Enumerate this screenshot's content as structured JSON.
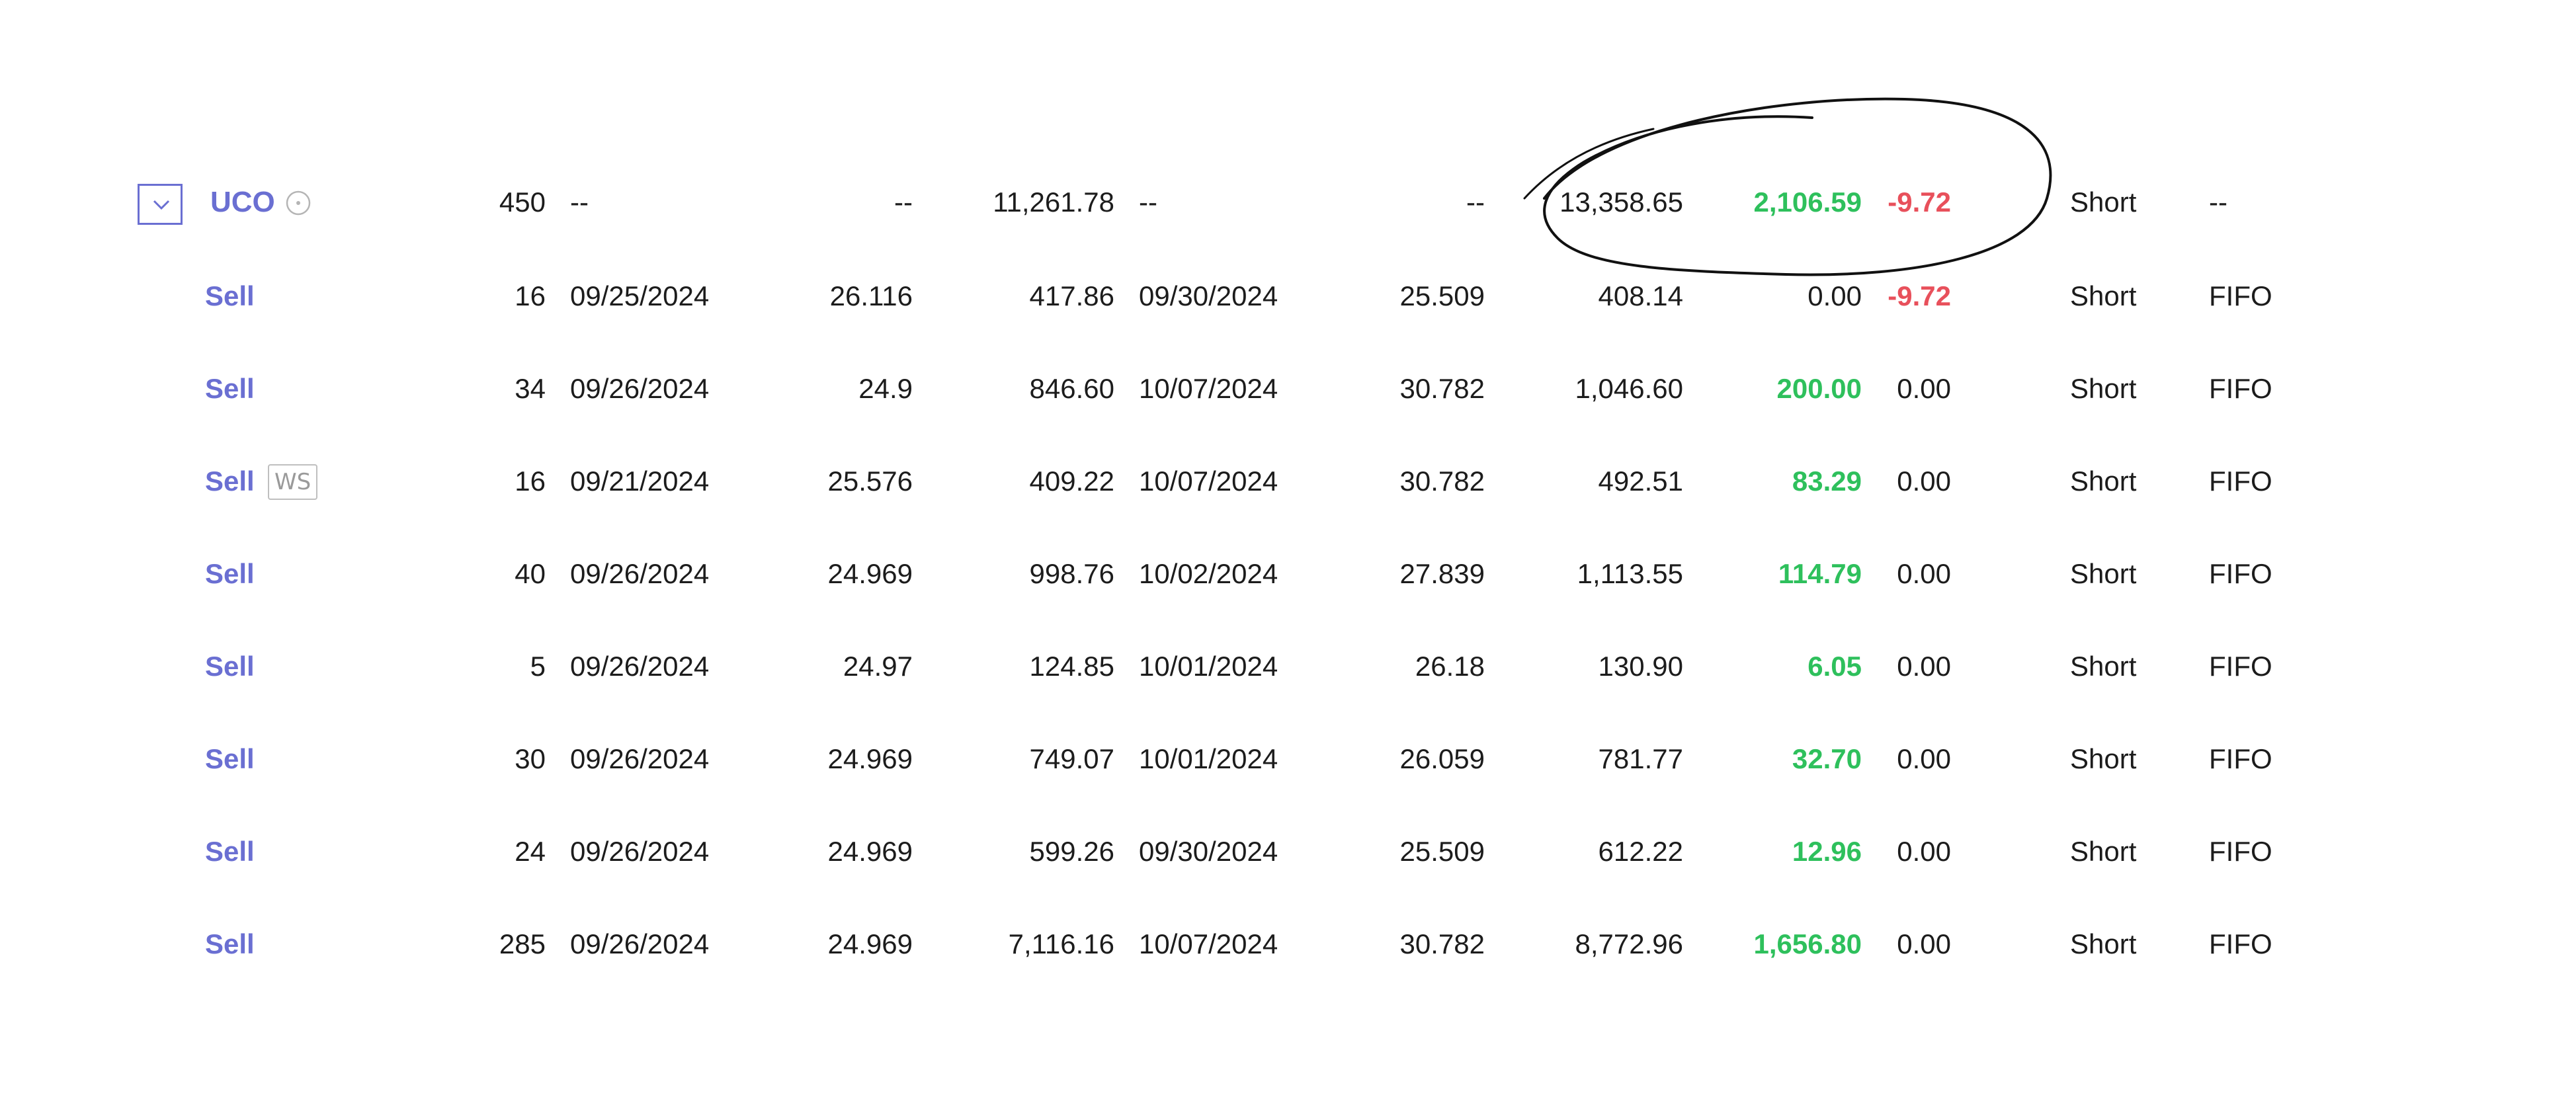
{
  "parent": {
    "symbol": "UCO",
    "quantity": "450",
    "open_date": "--",
    "open_price": "--",
    "cost_basis": "11,261.78",
    "close_date": "--",
    "close_price": "--",
    "proceeds": "13,358.65",
    "gain_loss": "2,106.59",
    "wash_sale": "-9.72",
    "term": "Short",
    "method": "--"
  },
  "lots": [
    {
      "action": "Sell",
      "badge": "",
      "quantity": "16",
      "open_date": "09/25/2024",
      "open_price": "26.116",
      "cost_basis": "417.86",
      "close_date": "09/30/2024",
      "close_price": "25.509",
      "proceeds": "408.14",
      "gain_loss": "0.00",
      "gain_color": "neutral",
      "wash_sale": "-9.72",
      "wash_color": "red",
      "term": "Short",
      "method": "FIFO"
    },
    {
      "action": "Sell",
      "badge": "",
      "quantity": "34",
      "open_date": "09/26/2024",
      "open_price": "24.9",
      "cost_basis": "846.60",
      "close_date": "10/07/2024",
      "close_price": "30.782",
      "proceeds": "1,046.60",
      "gain_loss": "200.00",
      "gain_color": "green",
      "wash_sale": "0.00",
      "wash_color": "neutral",
      "term": "Short",
      "method": "FIFO"
    },
    {
      "action": "Sell",
      "badge": "WS",
      "quantity": "16",
      "open_date": "09/21/2024",
      "open_price": "25.576",
      "cost_basis": "409.22",
      "close_date": "10/07/2024",
      "close_price": "30.782",
      "proceeds": "492.51",
      "gain_loss": "83.29",
      "gain_color": "green",
      "wash_sale": "0.00",
      "wash_color": "neutral",
      "term": "Short",
      "method": "FIFO"
    },
    {
      "action": "Sell",
      "badge": "",
      "quantity": "40",
      "open_date": "09/26/2024",
      "open_price": "24.969",
      "cost_basis": "998.76",
      "close_date": "10/02/2024",
      "close_price": "27.839",
      "proceeds": "1,113.55",
      "gain_loss": "114.79",
      "gain_color": "green",
      "wash_sale": "0.00",
      "wash_color": "neutral",
      "term": "Short",
      "method": "FIFO"
    },
    {
      "action": "Sell",
      "badge": "",
      "quantity": "5",
      "open_date": "09/26/2024",
      "open_price": "24.97",
      "cost_basis": "124.85",
      "close_date": "10/01/2024",
      "close_price": "26.18",
      "proceeds": "130.90",
      "gain_loss": "6.05",
      "gain_color": "green",
      "wash_sale": "0.00",
      "wash_color": "neutral",
      "term": "Short",
      "method": "FIFO"
    },
    {
      "action": "Sell",
      "badge": "",
      "quantity": "30",
      "open_date": "09/26/2024",
      "open_price": "24.969",
      "cost_basis": "749.07",
      "close_date": "10/01/2024",
      "close_price": "26.059",
      "proceeds": "781.77",
      "gain_loss": "32.70",
      "gain_color": "green",
      "wash_sale": "0.00",
      "wash_color": "neutral",
      "term": "Short",
      "method": "FIFO"
    },
    {
      "action": "Sell",
      "badge": "",
      "quantity": "24",
      "open_date": "09/26/2024",
      "open_price": "24.969",
      "cost_basis": "599.26",
      "close_date": "09/30/2024",
      "close_price": "25.509",
      "proceeds": "612.22",
      "gain_loss": "12.96",
      "gain_color": "green",
      "wash_sale": "0.00",
      "wash_color": "neutral",
      "term": "Short",
      "method": "FIFO"
    },
    {
      "action": "Sell",
      "badge": "",
      "quantity": "285",
      "open_date": "09/26/2024",
      "open_price": "24.969",
      "cost_basis": "7,116.16",
      "close_date": "10/07/2024",
      "close_price": "30.782",
      "proceeds": "8,772.96",
      "gain_loss": "1,656.80",
      "gain_color": "green",
      "wash_sale": "0.00",
      "wash_color": "neutral",
      "term": "Short",
      "method": "FIFO"
    }
  ],
  "colors": {
    "accent": "#6a6fd2",
    "gain_positive": "#2ec05c",
    "loss_negative": "#e8505b",
    "text": "#1c1c1c",
    "badge_border": "#bfbfbf"
  },
  "icons": {
    "expand": "chevron-down-icon",
    "info": "info-icon",
    "annotation": "hand-drawn-circle"
  }
}
